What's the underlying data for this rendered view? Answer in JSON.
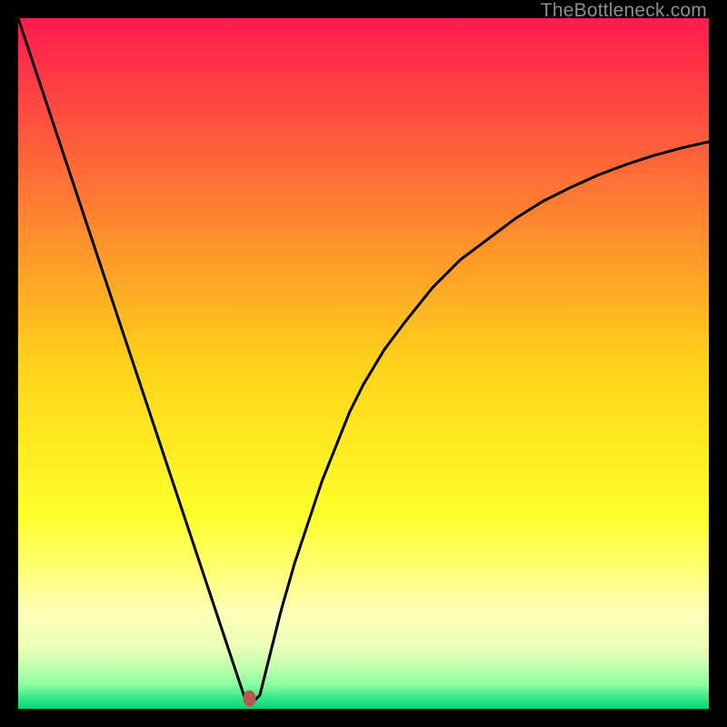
{
  "watermark": "TheBottleneck.com",
  "chart_data": {
    "type": "line",
    "title": "",
    "xlabel": "",
    "ylabel": "",
    "xlim": [
      0,
      100
    ],
    "ylim": [
      0,
      100
    ],
    "minimum_x": 33,
    "marker": {
      "x": 33.5,
      "y": 1.5,
      "color": "#b75a55"
    },
    "background_gradient": [
      {
        "pos": 0.0,
        "color": "#ff1a4e"
      },
      {
        "pos": 0.5,
        "color": "#ffd21a"
      },
      {
        "pos": 0.72,
        "color": "#ffff2a"
      },
      {
        "pos": 0.8,
        "color": "#ffff77"
      },
      {
        "pos": 0.86,
        "color": "#ffffb8"
      },
      {
        "pos": 0.905,
        "color": "#eeffb8"
      },
      {
        "pos": 0.935,
        "color": "#c8ffb0"
      },
      {
        "pos": 0.965,
        "color": "#8affa0"
      },
      {
        "pos": 0.985,
        "color": "#33e688"
      },
      {
        "pos": 1.0,
        "color": "#00d870"
      }
    ],
    "series": [
      {
        "name": "bottleneck-curve",
        "x": [
          0,
          2,
          4,
          6,
          8,
          10,
          12,
          14,
          16,
          18,
          20,
          22,
          24,
          26,
          28,
          30,
          31,
          32,
          33,
          34,
          35,
          36,
          37,
          38,
          40,
          42,
          44,
          46,
          48,
          50,
          53,
          56,
          60,
          64,
          68,
          72,
          76,
          80,
          84,
          88,
          92,
          96,
          100
        ],
        "y": [
          100,
          94,
          88,
          82,
          76,
          70,
          64,
          58,
          52,
          46,
          40,
          34,
          28,
          22,
          16,
          10,
          7,
          4,
          1,
          1,
          2,
          6,
          10,
          14,
          21,
          27,
          33,
          38,
          43,
          47,
          52,
          56,
          61,
          65,
          68,
          71,
          73.5,
          75.5,
          77.3,
          78.8,
          80.1,
          81.2,
          82.1
        ]
      }
    ]
  }
}
